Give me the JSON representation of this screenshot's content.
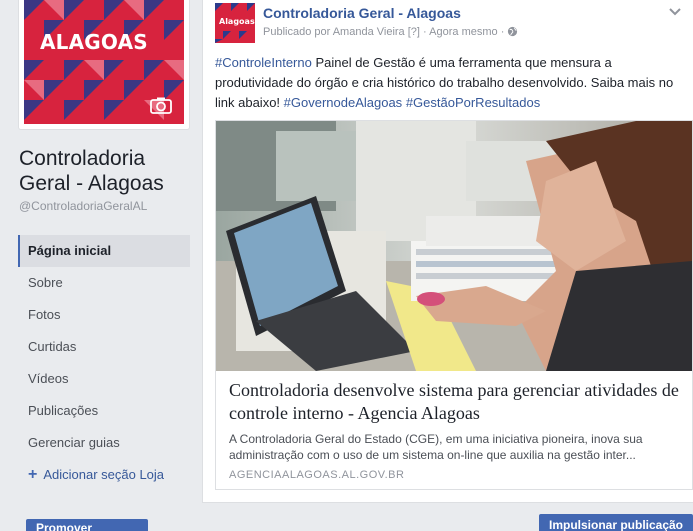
{
  "sidebar": {
    "profile_logo": "ALAGOAS",
    "page_name": "Controladoria Geral - Alagoas",
    "page_handle": "@ControladoriaGeralAL",
    "nav": [
      {
        "label": "Página inicial",
        "active": true
      },
      {
        "label": "Sobre"
      },
      {
        "label": "Fotos"
      },
      {
        "label": "Curtidas"
      },
      {
        "label": "Vídeos"
      },
      {
        "label": "Publicações"
      },
      {
        "label": "Gerenciar guias"
      }
    ],
    "add_section_label": "Adicionar seção Loja",
    "promote_label": "Promover"
  },
  "post": {
    "avatar_logo": "Alagoas",
    "author": "Controladoria Geral - Alagoas",
    "meta_prefix": "Publicado por Amanda Vieira",
    "meta_help": "[?]",
    "meta_time": "Agora mesmo",
    "text_tag1": "#ControleInterno",
    "text_body": " Painel de Gestão é uma ferramenta que mensura a produtividade do órgão e cria histórico do trabalho desenvolvido. Saiba mais no link abaixo! ",
    "text_tag2": "#GovernodeAlagoas",
    "text_tag3": "#GestãoPorResultados",
    "link": {
      "title": "Controladoria desenvolve sistema para gerenciar atividades de controle interno - Agencia Alagoas",
      "description": "A Controladoria Geral do Estado (CGE), em uma iniciativa pioneira, inova sua administração com o uso de um sistema on-line que auxilia na gestão inter...",
      "domain": "AGENCIAALAGOAS.AL.GOV.BR"
    }
  },
  "boost_label": "Impulsionar publicação",
  "colors": {
    "brand_red": "#d7233e",
    "fb_blue": "#4267b2",
    "link_blue": "#365899"
  }
}
